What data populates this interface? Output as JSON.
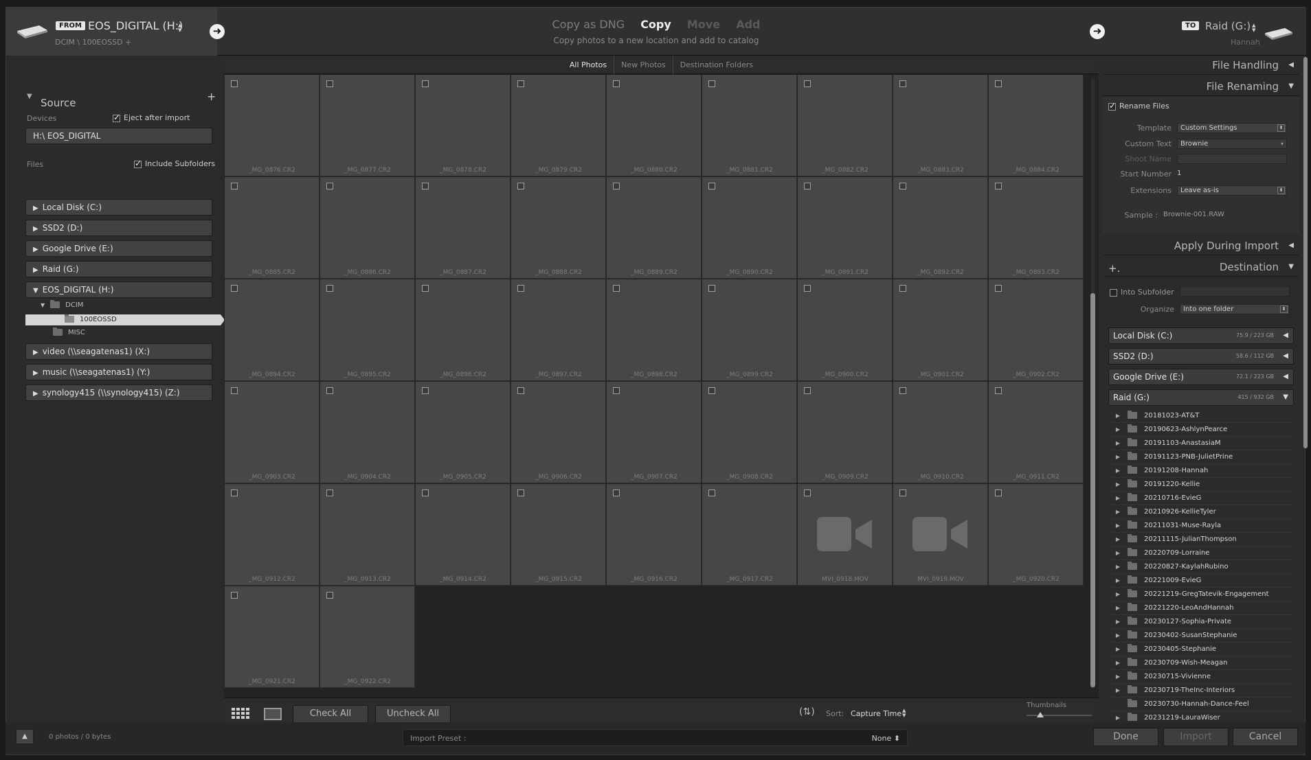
{
  "header": {
    "from_badge": "FROM",
    "from_name": "EOS_DIGITAL (H:)",
    "from_path": "DCIM \\ 100EOSSD +",
    "modes": [
      "Copy as DNG",
      "Copy",
      "Move",
      "Add"
    ],
    "active_mode": "Copy",
    "mode_description": "Copy photos to a new location and add to catalog",
    "to_badge": "TO",
    "to_name": "Raid (G:)",
    "to_sub": "Hannah"
  },
  "source": {
    "title": "Source",
    "devices_label": "Devices",
    "eject_label": "Eject after import",
    "eject_checked": true,
    "device_name": "H:\\ EOS_DIGITAL",
    "files_label": "Files",
    "subfolders_label": "Include Subfolders",
    "subfolders_checked": true,
    "drives": [
      {
        "label": "Local Disk (C:)",
        "expanded": false
      },
      {
        "label": "SSD2 (D:)",
        "expanded": false
      },
      {
        "label": "Google Drive (E:)",
        "expanded": false
      },
      {
        "label": "Raid (G:)",
        "expanded": false
      },
      {
        "label": "EOS_DIGITAL (H:)",
        "expanded": true
      }
    ],
    "tree": {
      "dcim": "DCIM",
      "selected": "100EOSSD",
      "misc": "MISC"
    },
    "network_drives": [
      {
        "label": "video (\\\\seagatenas1) (X:)"
      },
      {
        "label": "music (\\\\seagatenas1) (Y:)"
      },
      {
        "label": "synology415 (\\\\synology415) (Z:)"
      }
    ]
  },
  "grid": {
    "tabs": [
      "All Photos",
      "New Photos",
      "Destination Folders"
    ],
    "active_tab": "All Photos",
    "files": [
      "_MG_0876.CR2",
      "_MG_0877.CR2",
      "_MG_0878.CR2",
      "_MG_0879.CR2",
      "_MG_0880.CR2",
      "_MG_0881.CR2",
      "_MG_0882.CR2",
      "_MG_0883.CR2",
      "_MG_0884.CR2",
      "_MG_0885.CR2",
      "_MG_0886.CR2",
      "_MG_0887.CR2",
      "_MG_0888.CR2",
      "_MG_0889.CR2",
      "_MG_0890.CR2",
      "_MG_0891.CR2",
      "_MG_0892.CR2",
      "_MG_0893.CR2",
      "_MG_0894.CR2",
      "_MG_0895.CR2",
      "_MG_0896.CR2",
      "_MG_0897.CR2",
      "_MG_0898.CR2",
      "_MG_0899.CR2",
      "_MG_0900.CR2",
      "_MG_0901.CR2",
      "_MG_0902.CR2",
      "_MG_0903.CR2",
      "_MG_0904.CR2",
      "_MG_0905.CR2",
      "_MG_0906.CR2",
      "_MG_0907.CR2",
      "_MG_0908.CR2",
      "_MG_0909.CR2",
      "_MG_0910.CR2",
      "_MG_0911.CR2",
      "_MG_0912.CR2",
      "_MG_0913.CR2",
      "_MG_0914.CR2",
      "_MG_0915.CR2",
      "_MG_0916.CR2",
      "_MG_0917.CR2",
      "MVI_0918.MOV",
      "MVI_0919.MOV",
      "_MG_0920.CR2",
      "_MG_0921.CR2",
      "_MG_0922.CR2"
    ],
    "video_files": [
      "MVI_0918.MOV",
      "MVI_0919.MOV"
    ],
    "check_all": "Check All",
    "uncheck_all": "Uncheck All",
    "sort_label": "Sort:",
    "sort_value": "Capture Time",
    "thumbnails_label": "Thumbnails"
  },
  "file_handling": {
    "title": "File Handling"
  },
  "file_renaming": {
    "title": "File Renaming",
    "rename_label": "Rename Files",
    "rename_checked": true,
    "template_label": "Template",
    "template_value": "Custom Settings",
    "custom_text_label": "Custom Text",
    "custom_text_value": "Brownie",
    "shoot_name_label": "Shoot Name",
    "start_number_label": "Start Number",
    "start_number_value": "1",
    "extensions_label": "Extensions",
    "extensions_value": "Leave as-is",
    "sample_label": "Sample :",
    "sample_value": "Brownie-001.RAW"
  },
  "apply_during_import": {
    "title": "Apply During Import"
  },
  "destination": {
    "title": "Destination",
    "subfolder_label": "Into Subfolder",
    "organize_label": "Organize",
    "organize_value": "Into one folder",
    "drives": [
      {
        "label": "Local Disk (C:)",
        "size": "75.9 / 223 GB"
      },
      {
        "label": "SSD2 (D:)",
        "size": "58.6 / 112 GB"
      },
      {
        "label": "Google Drive (E:)",
        "size": "72.1 / 223 GB"
      },
      {
        "label": "Raid (G:)",
        "size": "415 / 932 GB"
      }
    ],
    "folders": [
      "20181023-AT&T",
      "20190623-AshlynPearce",
      "20191103-AnastasiaM",
      "20191123-PNB-JulietPrine",
      "20191208-Hannah",
      "20191220-Kellie",
      "20210716-EvieG",
      "20210926-KellieTyler",
      "20211031-Muse-Rayla",
      "20211115-JulianThompson",
      "20220709-Lorraine",
      "20220827-KaylahRubino",
      "20221009-EvieG",
      "20221219-GregTatevik-Engagement",
      "20221220-LeoAndHannah",
      "20230127-Sophia-Private",
      "20230402-SusanStephanie",
      "20230405-Stephanie",
      "20230709-Wish-Meagan",
      "20230715-Vivienne",
      "20230719-TheInc-Interiors",
      "20230730-Hannah-Dance-Feel",
      "20231219-LauraWiser"
    ]
  },
  "footer": {
    "count": "0 photos / 0 bytes",
    "preset_label": "Import Preset :",
    "preset_value": "None ⬍",
    "done": "Done",
    "import": "Import",
    "cancel": "Cancel"
  }
}
